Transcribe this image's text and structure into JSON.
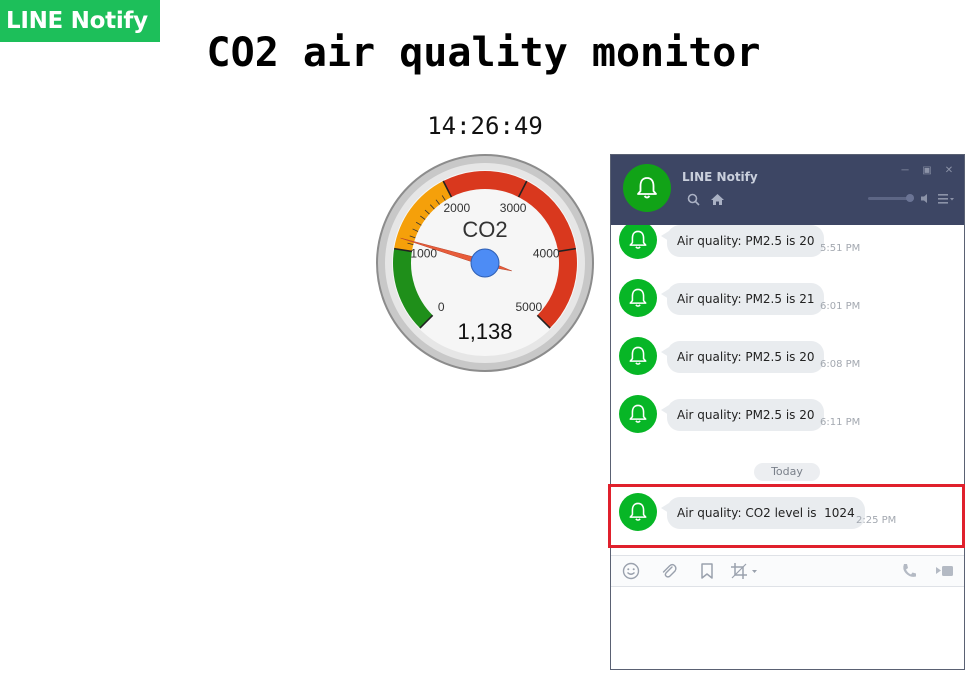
{
  "brand": {
    "label": "LINE Notify"
  },
  "page": {
    "title": "CO2 air quality monitor",
    "clock": "14:26:49"
  },
  "gauge": {
    "label": "CO2",
    "value_text": "1,138",
    "value": 1138,
    "min": 0,
    "max": 5000,
    "ticks": [
      "0",
      "1000",
      "2000",
      "3000",
      "4000",
      "5000"
    ],
    "bands": [
      {
        "from": 0,
        "to": 1000,
        "color": "#1f8f1a"
      },
      {
        "from": 1000,
        "to": 2000,
        "color": "#f5a00a"
      },
      {
        "from": 2000,
        "to": 5000,
        "color": "#d9381e"
      }
    ],
    "needle_color": "#e85c3a",
    "hub_color": "#4d8cf5"
  },
  "line_window": {
    "contact_name": "LINE Notify",
    "icons": [
      "search-icon",
      "home-icon",
      "minimize-icon",
      "maximize-icon",
      "close-icon",
      "speaker-icon",
      "menu-icon"
    ],
    "messages": [
      {
        "text": "Air quality: PM2.5 is 20",
        "time": "5:51 PM"
      },
      {
        "text": "Air quality: PM2.5 is 21",
        "time": "6:01 PM"
      },
      {
        "text": "Air quality: PM2.5 is 20",
        "time": "6:08 PM"
      },
      {
        "text": "Air quality: PM2.5 is 20",
        "time": "6:11 PM"
      }
    ],
    "day_separator": "Today",
    "latest_message": {
      "text": "Air quality: CO2 level is  1024",
      "time": "2:25 PM"
    },
    "toolbar_icons": [
      "emoji-icon",
      "attach-icon",
      "bookmark-icon",
      "crop-icon",
      "phone-icon",
      "video-icon"
    ],
    "accent": "#07b626",
    "header_bg": "#3d4664",
    "highlight_color": "#e0202c"
  }
}
